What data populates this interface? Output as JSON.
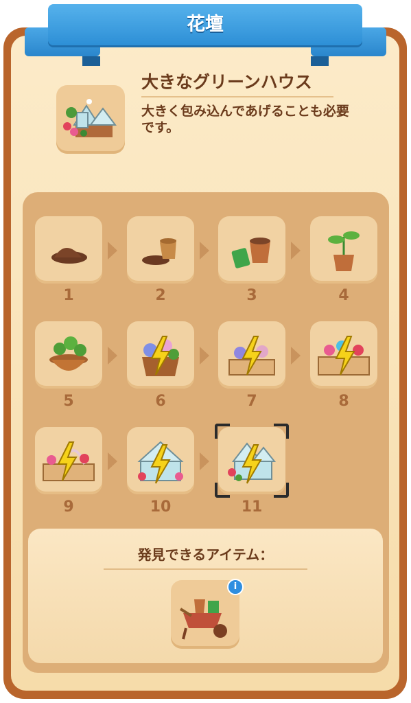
{
  "header": {
    "title": "花壇"
  },
  "item": {
    "name": "大きなグリーンハウス",
    "description": "大きく包み込んであげることも必要です。",
    "icon": "greenhouse-icon"
  },
  "stages": [
    {
      "number": "1",
      "icon": "dirt-pile-icon",
      "energy": false
    },
    {
      "number": "2",
      "icon": "tipped-pot-icon",
      "energy": false
    },
    {
      "number": "3",
      "icon": "pot-seeds-icon",
      "energy": false
    },
    {
      "number": "4",
      "icon": "sprout-pot-icon",
      "energy": false
    },
    {
      "number": "5",
      "icon": "leafy-pot-icon",
      "energy": false
    },
    {
      "number": "6",
      "icon": "flower-planter-icon",
      "energy": true
    },
    {
      "number": "7",
      "icon": "fenced-bed-icon",
      "energy": true
    },
    {
      "number": "8",
      "icon": "flower-bed-icon",
      "energy": true
    },
    {
      "number": "9",
      "icon": "arch-bed-icon",
      "energy": true
    },
    {
      "number": "10",
      "icon": "small-greenhouse-icon",
      "energy": true
    },
    {
      "number": "11",
      "icon": "greenhouse-icon",
      "energy": true,
      "selected": true
    }
  ],
  "discoverable": {
    "title": "発見できるアイテム：",
    "item_icon": "wheelbarrow-icon",
    "info_label": "i"
  },
  "colors": {
    "ribbon": "#3a9de2",
    "frame": "#b9652c",
    "energy": "#f6d21a",
    "number": "#a86a3a"
  }
}
